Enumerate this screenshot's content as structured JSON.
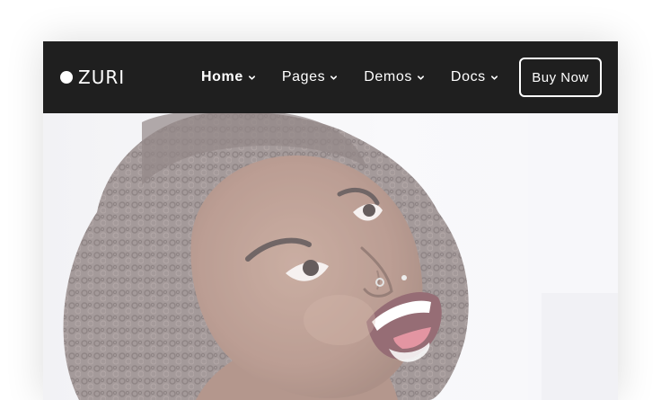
{
  "brand": {
    "name": "ZURI"
  },
  "nav": {
    "items": [
      {
        "label": "Home",
        "active": true
      },
      {
        "label": "Pages",
        "active": false
      },
      {
        "label": "Demos",
        "active": false
      },
      {
        "label": "Docs",
        "active": false
      }
    ],
    "cta_label": "Buy Now"
  },
  "hero": {
    "image": "smiling-woman-photo"
  },
  "colors": {
    "navbar_bg": "#1f1f1f",
    "text": "#ffffff"
  }
}
